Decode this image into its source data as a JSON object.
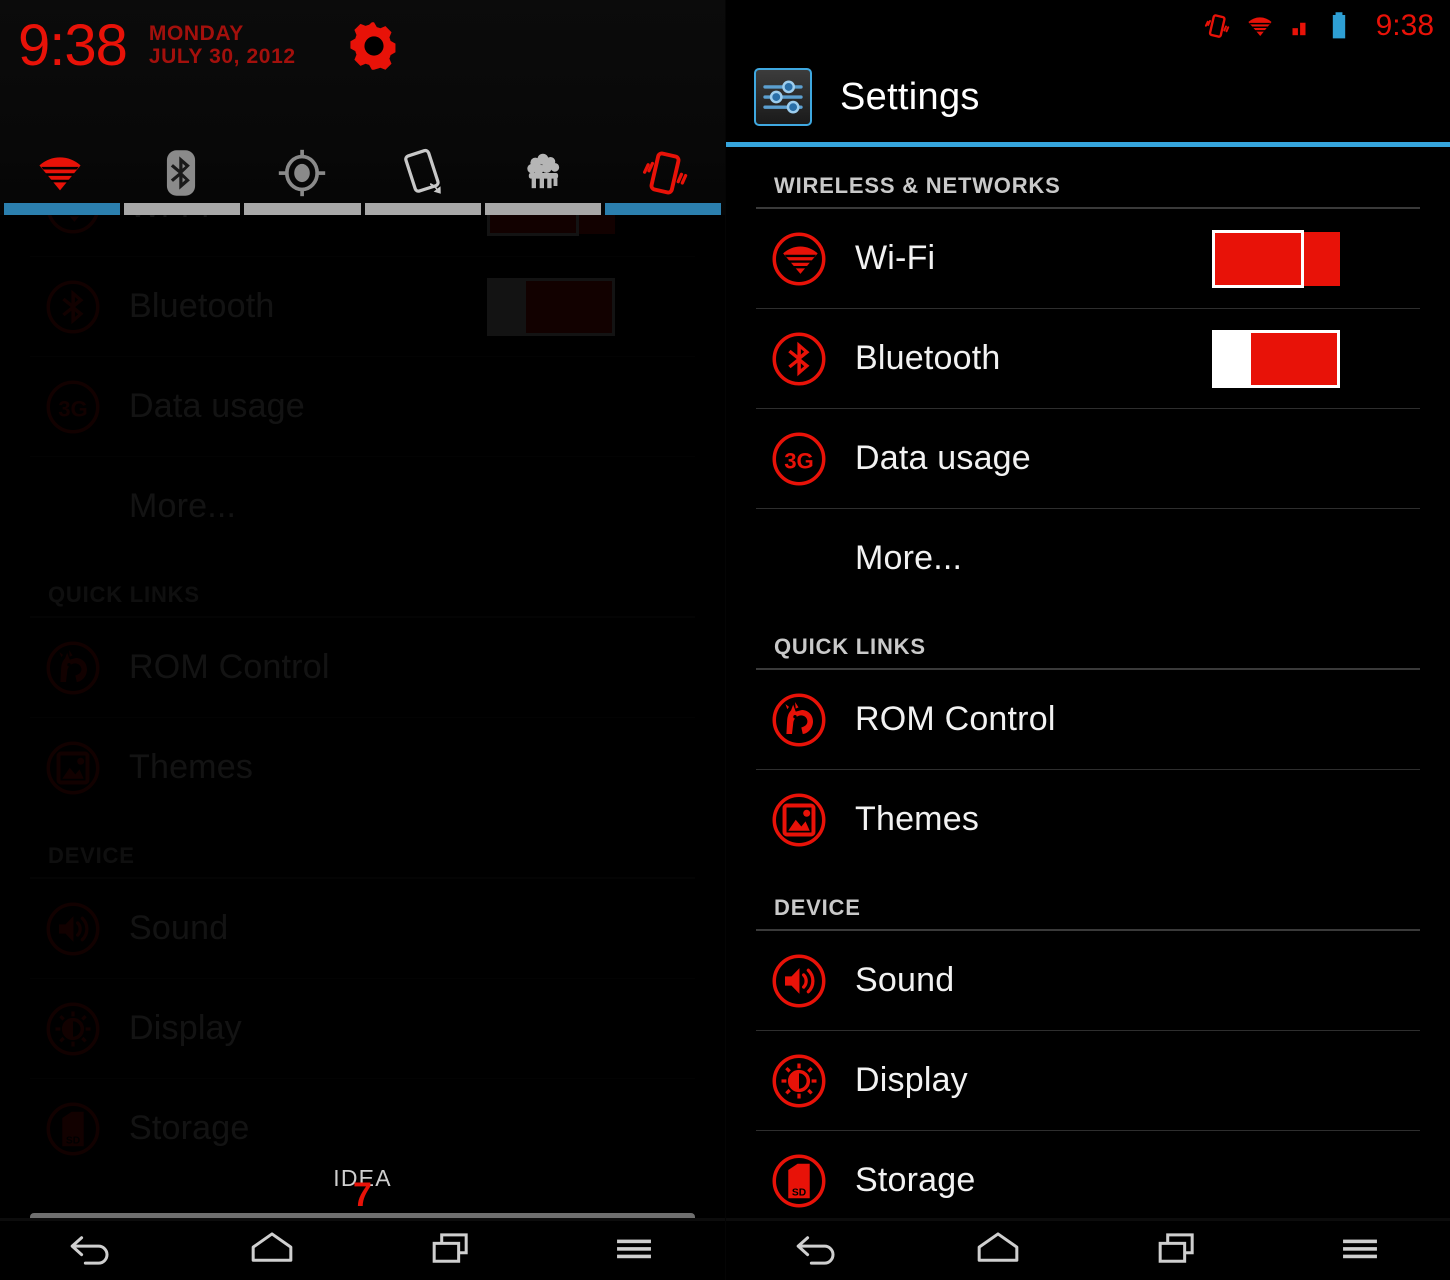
{
  "meta": {
    "accent_red": "#e81208",
    "accent_blue": "#35a5dd",
    "toggle_on_bar": "#2b7fae",
    "toggle_off_bar": "#a8a8a8",
    "background": "#000000"
  },
  "notification_shade": {
    "clock_time": "9:38",
    "date_day": "MONDAY",
    "date_full": "JULY 30, 2012",
    "settings_gear_icon": "gear-icon",
    "quick_toggles": [
      {
        "name": "wifi-toggle",
        "label": "Wi-Fi",
        "icon": "wifi-icon",
        "state": "on"
      },
      {
        "name": "bluetooth-toggle",
        "label": "Bluetooth",
        "icon": "bluetooth-icon",
        "state": "off"
      },
      {
        "name": "gps-toggle",
        "label": "GPS",
        "icon": "gps-icon",
        "state": "off"
      },
      {
        "name": "autorotate-toggle",
        "label": "Auto-rotate",
        "icon": "rotate-icon",
        "state": "off"
      },
      {
        "name": "sleep-toggle",
        "label": "Sleep",
        "icon": "sheep-icon",
        "state": "off"
      },
      {
        "name": "vibrate-toggle",
        "label": "Vibrate",
        "icon": "vibrate-icon",
        "state": "on"
      }
    ],
    "carrier_label": "IDEA",
    "brightness_value": "7"
  },
  "status_bar": {
    "time": "9:38",
    "icons": [
      "vibrate-icon",
      "wifi-signal-icon",
      "cell-signal-icon",
      "battery-icon"
    ],
    "battery_color": "#2e9fd4"
  },
  "app_header": {
    "title": "Settings",
    "icon": "settings-sliders-icon"
  },
  "settings": {
    "sections": [
      {
        "header": "WIRELESS & NETWORKS",
        "rows": [
          {
            "label": "Wi-Fi",
            "icon": "wifi-icon",
            "toggle": "on",
            "indent": false
          },
          {
            "label": "Bluetooth",
            "icon": "bluetooth-icon",
            "toggle": "off",
            "indent": false
          },
          {
            "label": "Data usage",
            "icon": "data-3g-icon",
            "toggle": null,
            "indent": false
          },
          {
            "label": "More...",
            "icon": null,
            "toggle": null,
            "indent": true
          }
        ]
      },
      {
        "header": "QUICK LINKS",
        "rows": [
          {
            "label": "ROM Control",
            "icon": "unicorn-icon",
            "toggle": null,
            "indent": false
          },
          {
            "label": "Themes",
            "icon": "themes-icon",
            "toggle": null,
            "indent": false
          }
        ]
      },
      {
        "header": "DEVICE",
        "rows": [
          {
            "label": "Sound",
            "icon": "speaker-icon",
            "toggle": null,
            "indent": false
          },
          {
            "label": "Display",
            "icon": "display-icon",
            "toggle": null,
            "indent": false
          },
          {
            "label": "Storage",
            "icon": "sdcard-icon",
            "toggle": null,
            "indent": false
          }
        ]
      }
    ]
  },
  "nav_bar": {
    "buttons": [
      {
        "name": "back-button",
        "icon": "back-arrow-icon"
      },
      {
        "name": "home-button",
        "icon": "home-icon"
      },
      {
        "name": "recents-button",
        "icon": "recents-icon"
      },
      {
        "name": "menu-button",
        "icon": "menu-icon"
      }
    ]
  }
}
